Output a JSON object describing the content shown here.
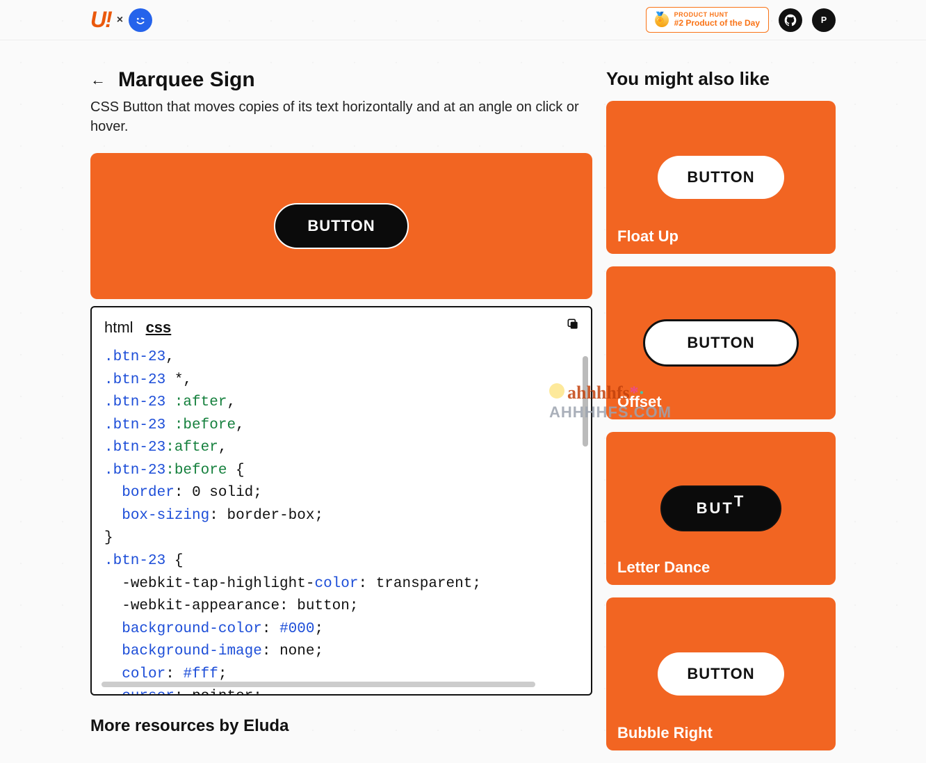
{
  "header": {
    "logo_u": "U!",
    "logo_x": "×",
    "ph_label": "PRODUCT HUNT",
    "ph_sub": "#2 Product of the Day"
  },
  "page": {
    "title": "Marquee Sign",
    "description": "CSS Button that moves copies of its text horizontally and at an angle on click or hover.",
    "demo_button": "BUTTON"
  },
  "code": {
    "tab_html": "html",
    "tab_css": "css",
    "lines": [
      {
        "t": "sel",
        "s": ".btn-23"
      },
      {
        "t": "punct",
        "s": ","
      },
      {
        "t": "nl"
      },
      {
        "t": "sel",
        "s": ".btn-23"
      },
      {
        "t": "punct",
        "s": " *,"
      },
      {
        "t": "nl"
      },
      {
        "t": "sel",
        "s": ".btn-23 "
      },
      {
        "t": "pcls",
        "s": ":after"
      },
      {
        "t": "punct",
        "s": ","
      },
      {
        "t": "nl"
      },
      {
        "t": "sel",
        "s": ".btn-23 "
      },
      {
        "t": "pcls",
        "s": ":before"
      },
      {
        "t": "punct",
        "s": ","
      },
      {
        "t": "nl"
      },
      {
        "t": "sel",
        "s": ".btn-23"
      },
      {
        "t": "pcls",
        "s": ":after"
      },
      {
        "t": "punct",
        "s": ","
      },
      {
        "t": "nl"
      },
      {
        "t": "sel",
        "s": ".btn-23"
      },
      {
        "t": "pcls",
        "s": ":before"
      },
      {
        "t": "punct",
        "s": " {"
      },
      {
        "t": "nl"
      },
      {
        "t": "indent"
      },
      {
        "t": "prop",
        "s": "border"
      },
      {
        "t": "punct",
        "s": ": "
      },
      {
        "t": "val",
        "s": "0 solid"
      },
      {
        "t": "punct",
        "s": ";"
      },
      {
        "t": "nl"
      },
      {
        "t": "indent"
      },
      {
        "t": "prop",
        "s": "box-sizing"
      },
      {
        "t": "punct",
        "s": ": "
      },
      {
        "t": "val",
        "s": "border-box"
      },
      {
        "t": "punct",
        "s": ";"
      },
      {
        "t": "nl"
      },
      {
        "t": "punct",
        "s": "}"
      },
      {
        "t": "nl"
      },
      {
        "t": "sel",
        "s": ".btn-23"
      },
      {
        "t": "punct",
        "s": " {"
      },
      {
        "t": "nl"
      },
      {
        "t": "indent"
      },
      {
        "t": "val",
        "s": "-webkit-tap-highlight-"
      },
      {
        "t": "prop",
        "s": "color"
      },
      {
        "t": "punct",
        "s": ": "
      },
      {
        "t": "val",
        "s": "transparent"
      },
      {
        "t": "punct",
        "s": ";"
      },
      {
        "t": "nl"
      },
      {
        "t": "indent"
      },
      {
        "t": "val",
        "s": "-webkit-appearance: button"
      },
      {
        "t": "punct",
        "s": ";"
      },
      {
        "t": "nl"
      },
      {
        "t": "indent"
      },
      {
        "t": "prop",
        "s": "background-color"
      },
      {
        "t": "punct",
        "s": ": "
      },
      {
        "t": "hex",
        "s": "#000"
      },
      {
        "t": "punct",
        "s": ";"
      },
      {
        "t": "nl"
      },
      {
        "t": "indent"
      },
      {
        "t": "prop",
        "s": "background-image"
      },
      {
        "t": "punct",
        "s": ": "
      },
      {
        "t": "val",
        "s": "none"
      },
      {
        "t": "punct",
        "s": ";"
      },
      {
        "t": "nl"
      },
      {
        "t": "indent"
      },
      {
        "t": "prop",
        "s": "color"
      },
      {
        "t": "punct",
        "s": ": "
      },
      {
        "t": "hex",
        "s": "#fff"
      },
      {
        "t": "punct",
        "s": ";"
      },
      {
        "t": "nl"
      },
      {
        "t": "indent"
      },
      {
        "t": "prop",
        "s": "cursor"
      },
      {
        "t": "punct",
        "s": ": "
      },
      {
        "t": "val",
        "s": "pointer"
      },
      {
        "t": "punct",
        "s": ";"
      }
    ]
  },
  "more_heading": "More resources by Eluda",
  "sidebar": {
    "title": "You might also like",
    "cards": [
      {
        "label": "Float Up",
        "button": "BUTTON",
        "style": "white"
      },
      {
        "label": "Offset",
        "button": "BUTTON",
        "style": "outline"
      },
      {
        "label": "Letter Dance",
        "button": "BUT",
        "button_extra": "T",
        "style": "dark"
      },
      {
        "label": "Bubble Right",
        "button": "BUTTON",
        "style": "white"
      }
    ]
  },
  "watermark": {
    "line1": "ahhhhfs",
    "line2": "AHHHHFS.COM"
  }
}
